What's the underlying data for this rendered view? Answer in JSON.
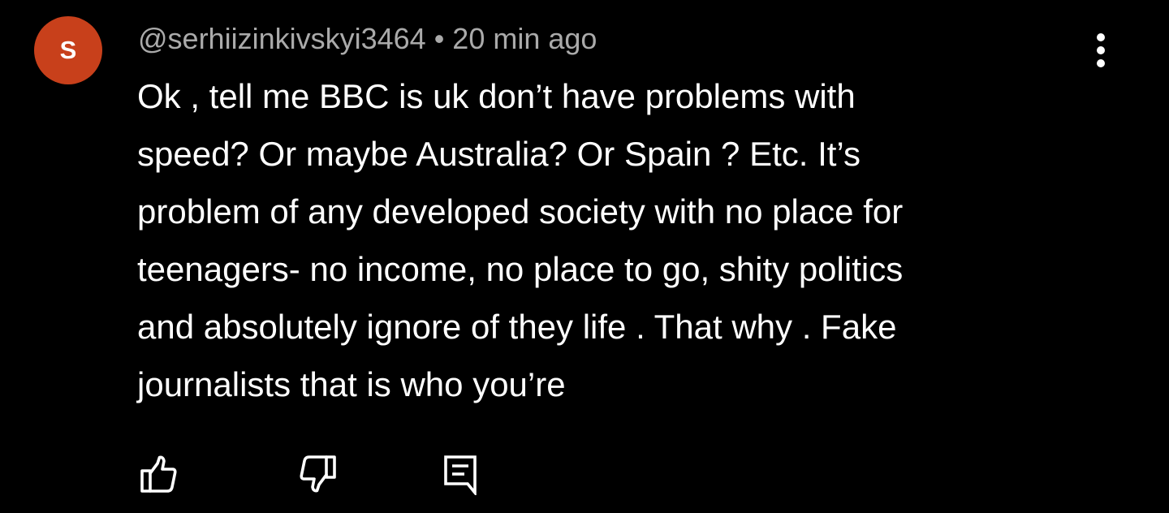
{
  "comment": {
    "avatar_letter": "S",
    "avatar_color": "#c8401b",
    "author_handle": "@serhiizinkivskyi3464",
    "separator": "•",
    "timestamp": "20 min ago",
    "text_lines": [
      "Ok , tell me BBC is uk don’t have problems with",
      "speed? Or maybe Australia? Or Spain ? Etc. It’s",
      "problem of any developed society with no place for",
      "teenagers- no income, no place to go, shity politics",
      "and absolutely ignore of they life . That why . Fake",
      "journalists that is who you’re"
    ]
  },
  "actions": {
    "like_icon": "thumbs-up-icon",
    "dislike_icon": "thumbs-down-icon",
    "reply_icon": "comment-reply-icon",
    "menu_icon": "more-vertical-icon"
  },
  "colors": {
    "background": "#000000",
    "text": "#ffffff",
    "meta_text": "#aaaaaa"
  }
}
